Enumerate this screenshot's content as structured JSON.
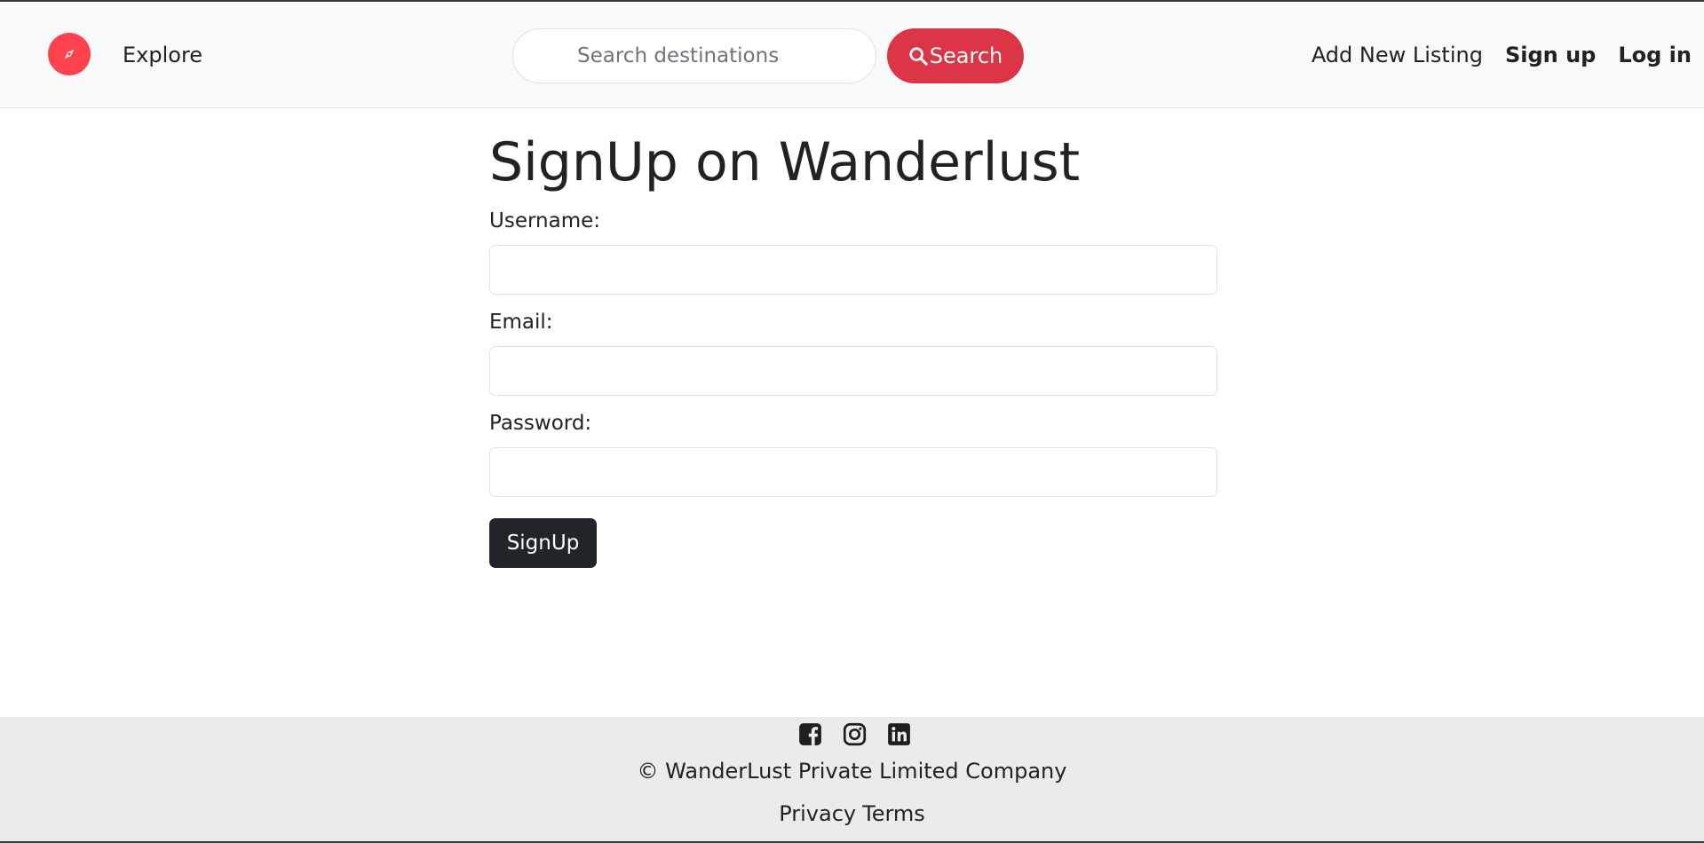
{
  "navbar": {
    "brand_icon": "compass-icon",
    "brand_color": "#fe424d",
    "explore_label": "Explore",
    "search_placeholder": "Search destinations",
    "search_value": "",
    "search_button_label": "Search",
    "search_button_color": "#dc3545",
    "add_listing_label": "Add New Listing",
    "signup_label": "Sign up",
    "login_label": "Log in"
  },
  "main": {
    "title": "SignUp on Wanderlust",
    "username_label": "Username:",
    "username_value": "",
    "email_label": "Email:",
    "email_value": "",
    "password_label": "Password:",
    "password_value": "",
    "submit_label": "SignUp",
    "submit_color": "#212529"
  },
  "footer": {
    "social_icons": [
      "facebook-icon",
      "instagram-icon",
      "linkedin-icon"
    ],
    "copyright": "© WanderLust Private Limited Company",
    "privacy_label": "Privacy",
    "terms_label": "Terms"
  }
}
